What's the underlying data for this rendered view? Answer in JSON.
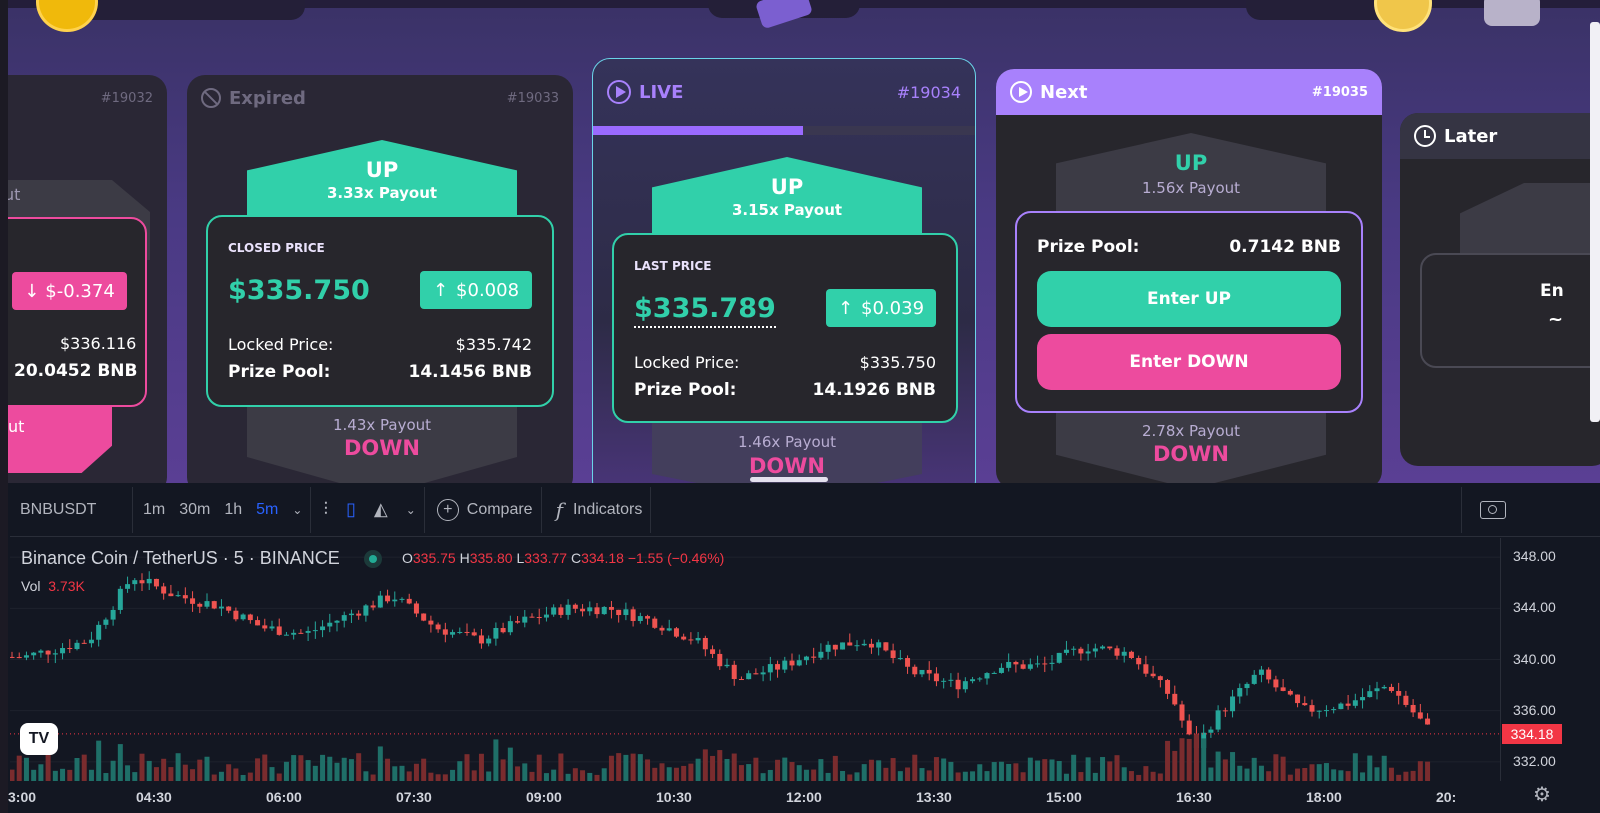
{
  "rounds": {
    "partial_left": {
      "id": "#19032",
      "payout_fragment": "ut",
      "change": "$-0.374",
      "closed_price_fragment": "$336.116",
      "pool_fragment": "20.0452 BNB",
      "down_fragment": "ut"
    },
    "expired": {
      "status": "Expired",
      "id": "#19033",
      "up_label": "UP",
      "up_payout": "3.33x Payout",
      "price_label": "CLOSED PRICE",
      "price": "$335.750",
      "change": "$0.008",
      "locked_label": "Locked Price:",
      "locked_value": "$335.742",
      "pool_label": "Prize Pool:",
      "pool_value": "14.1456 BNB",
      "down_payout": "1.43x Payout",
      "down_label": "DOWN"
    },
    "live": {
      "status": "LIVE",
      "id": "#19034",
      "progress": 0.55,
      "up_label": "UP",
      "up_payout": "3.15x Payout",
      "price_label": "LAST PRICE",
      "price": "$335.789",
      "change": "$0.039",
      "locked_label": "Locked Price:",
      "locked_value": "$335.750",
      "pool_label": "Prize Pool:",
      "pool_value": "14.1926 BNB",
      "down_payout": "1.46x Payout",
      "down_label": "DOWN"
    },
    "next": {
      "status": "Next",
      "id": "#19035",
      "up_label": "UP",
      "up_payout": "1.56x Payout",
      "pool_label": "Prize Pool:",
      "pool_value": "0.7142 BNB",
      "enter_up": "Enter UP",
      "enter_down": "Enter DOWN",
      "down_payout": "2.78x Payout",
      "down_label": "DOWN"
    },
    "later": {
      "status": "Later",
      "enter_fragment": "En",
      "dash_fragment": "~"
    }
  },
  "colors": {
    "up": "#31d0aa",
    "down": "#ed4b9e",
    "accent": "#a881fc",
    "candle_up": "#26a69a",
    "candle_down": "#ef5350"
  },
  "toolbar": {
    "symbol": "BNBUSDT",
    "intervals": [
      "1m",
      "30m",
      "1h",
      "5m"
    ],
    "active_interval": "5m",
    "compare": "Compare",
    "indicators": "Indicators"
  },
  "legend": {
    "title": "Binance Coin / TetherUS · 5 · BINANCE",
    "o_label": "O",
    "o": "335.75",
    "h_label": "H",
    "h": "335.80",
    "l_label": "L",
    "l": "333.77",
    "c_label": "C",
    "c": "334.18",
    "change": "−1.55 (−0.46%)",
    "vol_label": "Vol",
    "vol": "3.73K"
  },
  "chart_data": {
    "type": "candlestick",
    "symbol": "BNBUSDT",
    "interval": "5m",
    "price_axis_ticks": [
      "348.00",
      "344.00",
      "340.00",
      "336.00",
      "332.00"
    ],
    "last_price_tag": "334.18",
    "time_axis_ticks": [
      "3:00",
      "04:30",
      "06:00",
      "07:30",
      "09:00",
      "10:30",
      "12:00",
      "13:30",
      "15:00",
      "16:30",
      "18:00",
      "20:"
    ],
    "ylim": [
      330.5,
      349.5
    ],
    "close_path": [
      {
        "t": "03:00",
        "v": 340.2
      },
      {
        "t": "03:45",
        "v": 341.5
      },
      {
        "t": "04:15",
        "v": 346.5
      },
      {
        "t": "04:45",
        "v": 345.0
      },
      {
        "t": "05:15",
        "v": 344.2
      },
      {
        "t": "05:45",
        "v": 342.5
      },
      {
        "t": "06:15",
        "v": 342.0
      },
      {
        "t": "06:45",
        "v": 343.5
      },
      {
        "t": "07:15",
        "v": 345.0
      },
      {
        "t": "07:45",
        "v": 342.5
      },
      {
        "t": "08:15",
        "v": 341.5
      },
      {
        "t": "08:45",
        "v": 343.0
      },
      {
        "t": "09:15",
        "v": 344.0
      },
      {
        "t": "09:45",
        "v": 344.0
      },
      {
        "t": "10:15",
        "v": 343.0
      },
      {
        "t": "10:45",
        "v": 341.5
      },
      {
        "t": "11:15",
        "v": 338.5
      },
      {
        "t": "11:45",
        "v": 339.5
      },
      {
        "t": "12:15",
        "v": 341.0
      },
      {
        "t": "12:45",
        "v": 341.5
      },
      {
        "t": "13:15",
        "v": 339.0
      },
      {
        "t": "13:45",
        "v": 338.0
      },
      {
        "t": "14:15",
        "v": 339.5
      },
      {
        "t": "14:45",
        "v": 339.5
      },
      {
        "t": "15:15",
        "v": 341.0
      },
      {
        "t": "15:45",
        "v": 340.5
      },
      {
        "t": "16:15",
        "v": 337.0
      },
      {
        "t": "16:30",
        "v": 333.0
      },
      {
        "t": "16:45",
        "v": 335.5
      },
      {
        "t": "17:15",
        "v": 339.0
      },
      {
        "t": "17:45",
        "v": 336.0
      },
      {
        "t": "18:15",
        "v": 336.5
      },
      {
        "t": "18:45",
        "v": 338.0
      },
      {
        "t": "19:15",
        "v": 334.2
      }
    ]
  }
}
